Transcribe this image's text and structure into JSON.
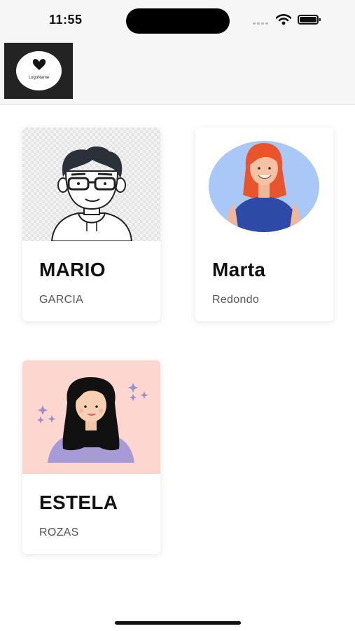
{
  "status_bar": {
    "time": "11:55"
  },
  "header": {
    "logo_text": "LogoName"
  },
  "profiles": [
    {
      "name": "MARIO",
      "surname": "GARCIA"
    },
    {
      "name": "Marta",
      "surname": "Redondo"
    },
    {
      "name": "ESTELA",
      "surname": "ROZAS"
    }
  ]
}
